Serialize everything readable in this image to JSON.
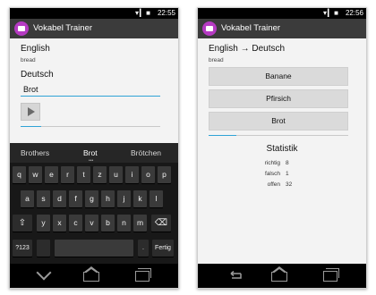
{
  "status": {
    "time_left": "22:55",
    "time_right": "22:56",
    "icons": "▾▎■"
  },
  "app": {
    "title": "Vokabel Trainer"
  },
  "left": {
    "source_lang": "English",
    "prompt_word": "bread",
    "target_lang": "Deutsch",
    "input_value": "Brot",
    "progress_fraction": 0.15,
    "suggestions": [
      "Brothers",
      "Brot",
      "Brötchen"
    ],
    "keyboard": {
      "row1": [
        "q",
        "w",
        "e",
        "r",
        "t",
        "z",
        "u",
        "i",
        "o",
        "p"
      ],
      "row2": [
        "a",
        "s",
        "d",
        "f",
        "g",
        "h",
        "j",
        "k",
        "l"
      ],
      "row3": [
        "y",
        "x",
        "c",
        "v",
        "b",
        "n",
        "m"
      ],
      "row4_left": "?123",
      "row4_dot": ".",
      "row4_done": "Fertig",
      "shift_icon": "⇧",
      "backspace_icon": "⌫"
    }
  },
  "right": {
    "heading": "English → Deutsch",
    "prompt_word": "bread",
    "choices": [
      "Banane",
      "Pfirsich",
      "Brot"
    ],
    "progress_fraction": 0.2,
    "stats": {
      "title": "Statistik",
      "rows": [
        {
          "label": "richtig",
          "value": "8"
        },
        {
          "label": "falsch",
          "value": "1"
        },
        {
          "label": "offen",
          "value": "32"
        }
      ]
    }
  }
}
